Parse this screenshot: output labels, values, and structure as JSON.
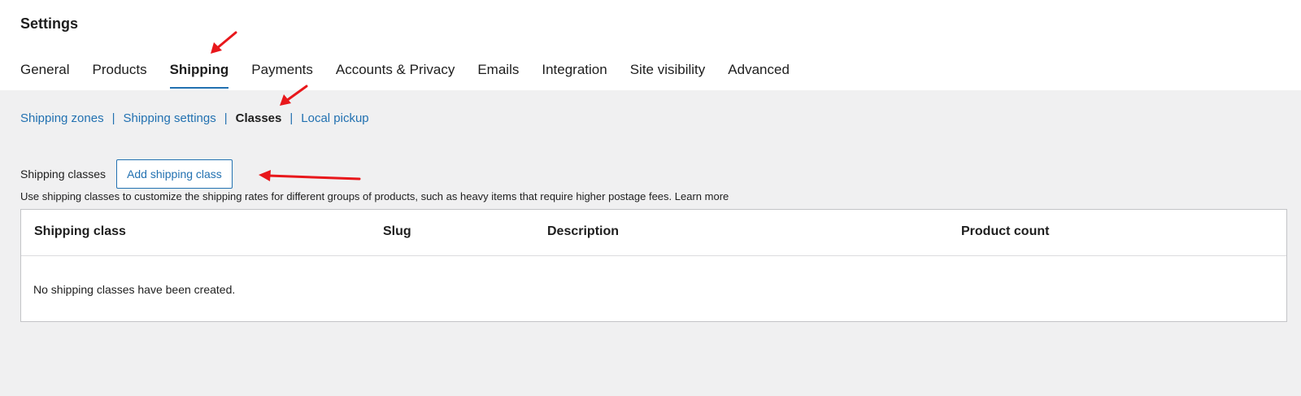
{
  "page_title": "Settings",
  "tabs": [
    {
      "label": "General"
    },
    {
      "label": "Products"
    },
    {
      "label": "Shipping",
      "active": true
    },
    {
      "label": "Payments"
    },
    {
      "label": "Accounts & Privacy"
    },
    {
      "label": "Emails"
    },
    {
      "label": "Integration"
    },
    {
      "label": "Site visibility"
    },
    {
      "label": "Advanced"
    }
  ],
  "subnav": {
    "items": [
      {
        "label": "Shipping zones"
      },
      {
        "label": "Shipping settings"
      },
      {
        "label": "Classes",
        "current": true
      },
      {
        "label": "Local pickup"
      }
    ],
    "separator": "|"
  },
  "section": {
    "label": "Shipping classes",
    "add_button": "Add shipping class",
    "help_text": "Use shipping classes to customize the shipping rates for different groups of products, such as heavy items that require higher postage fees.",
    "learn_more": "Learn more"
  },
  "table": {
    "columns": [
      "Shipping class",
      "Slug",
      "Description",
      "Product count"
    ],
    "empty_message": "No shipping classes have been created."
  },
  "colors": {
    "accent": "#2271b1",
    "annotation_arrow": "#e8171b",
    "background": "#f0f0f1"
  }
}
